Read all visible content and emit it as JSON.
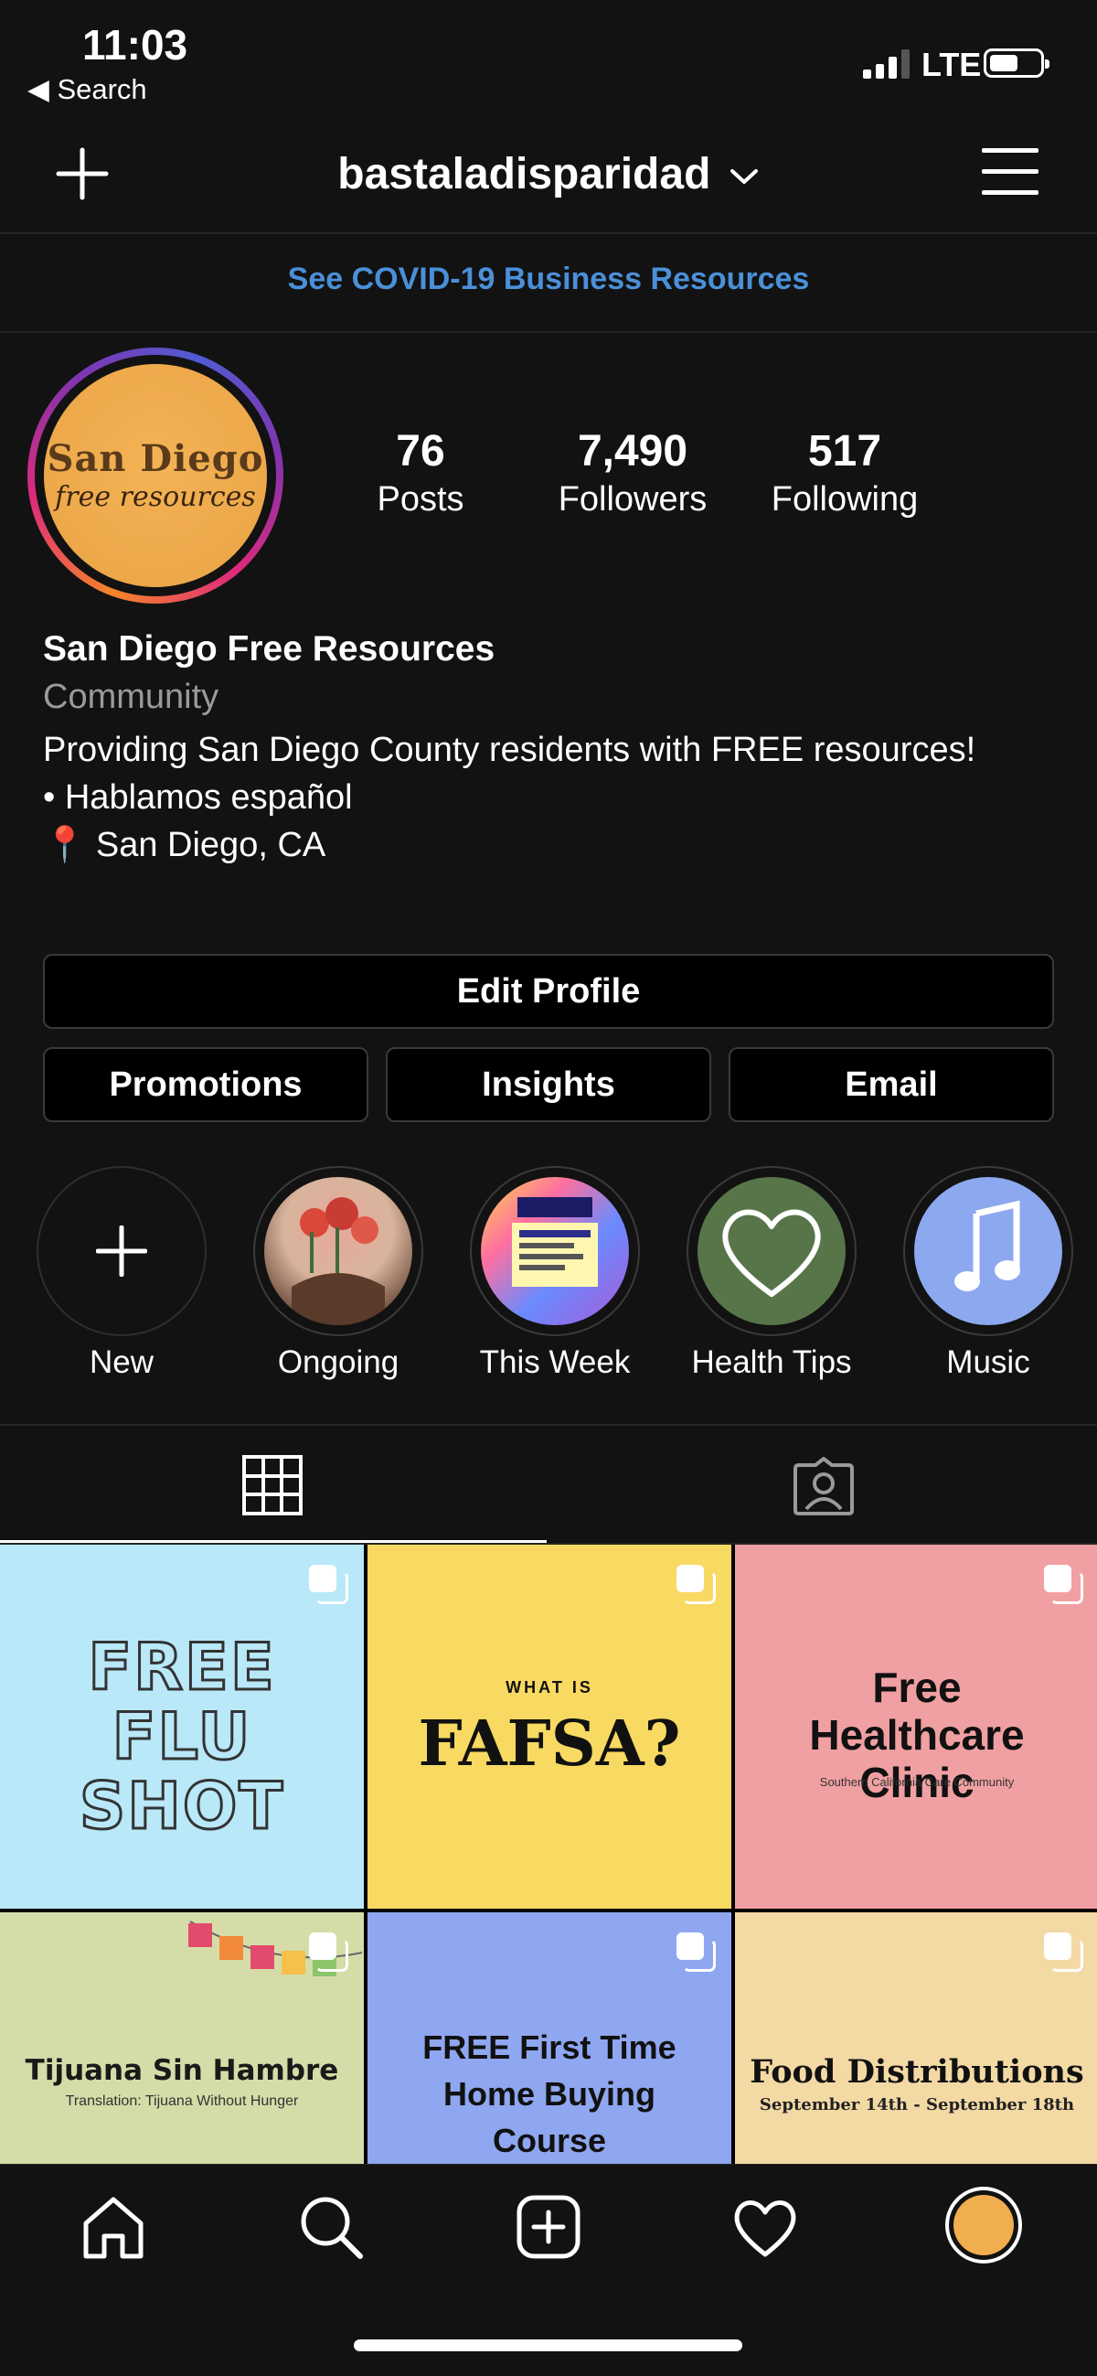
{
  "status_bar": {
    "time": "11:03",
    "back_label": "◀ Search",
    "network": "LTE"
  },
  "header": {
    "username": "bastaladisparidad"
  },
  "banner": {
    "covid_link": "See COVID-19 Business Resources"
  },
  "profile": {
    "avatar_text_line1": "San Diego",
    "avatar_text_line2": "free resources",
    "stats": [
      {
        "value": "76",
        "label": "Posts"
      },
      {
        "value": "7,490",
        "label": "Followers"
      },
      {
        "value": "517",
        "label": "Following"
      }
    ],
    "name": "San Diego Free Resources",
    "category": "Community",
    "bio": [
      "Providing San Diego County residents with FREE resources!",
      "• Hablamos español",
      "📍 San Diego, CA"
    ]
  },
  "buttons": {
    "edit_profile": "Edit Profile",
    "promotions": "Promotions",
    "insights": "Insights",
    "email": "Email"
  },
  "highlights": [
    {
      "label": "New"
    },
    {
      "label": "Ongoing"
    },
    {
      "label": "This Week"
    },
    {
      "label": "Health Tips"
    },
    {
      "label": "Music"
    }
  ],
  "posts": [
    {
      "lines": [
        "FREE",
        "FLU",
        "SHOT"
      ],
      "bg": "#b9e8f8"
    },
    {
      "kicker": "WHAT IS",
      "title": "FAFSA?",
      "bg": "#f8d962"
    },
    {
      "title": "Free Healthcare Clinic",
      "subtitle": "Southern California Care Community",
      "bg": "#f0a0a2"
    },
    {
      "title": "Tijuana Sin Hambre",
      "subtitle": "Translation: Tijuana Without Hunger",
      "bg": "#d6dca8"
    },
    {
      "title": "FREE First Time Home Buying Course",
      "bg": "#8fa6f0"
    },
    {
      "title": "Food Distributions",
      "subtitle": "September 14th - September 18th",
      "bg": "#f3d9a4"
    }
  ],
  "colors": {
    "link": "#4a90d9",
    "background": "#121212"
  }
}
